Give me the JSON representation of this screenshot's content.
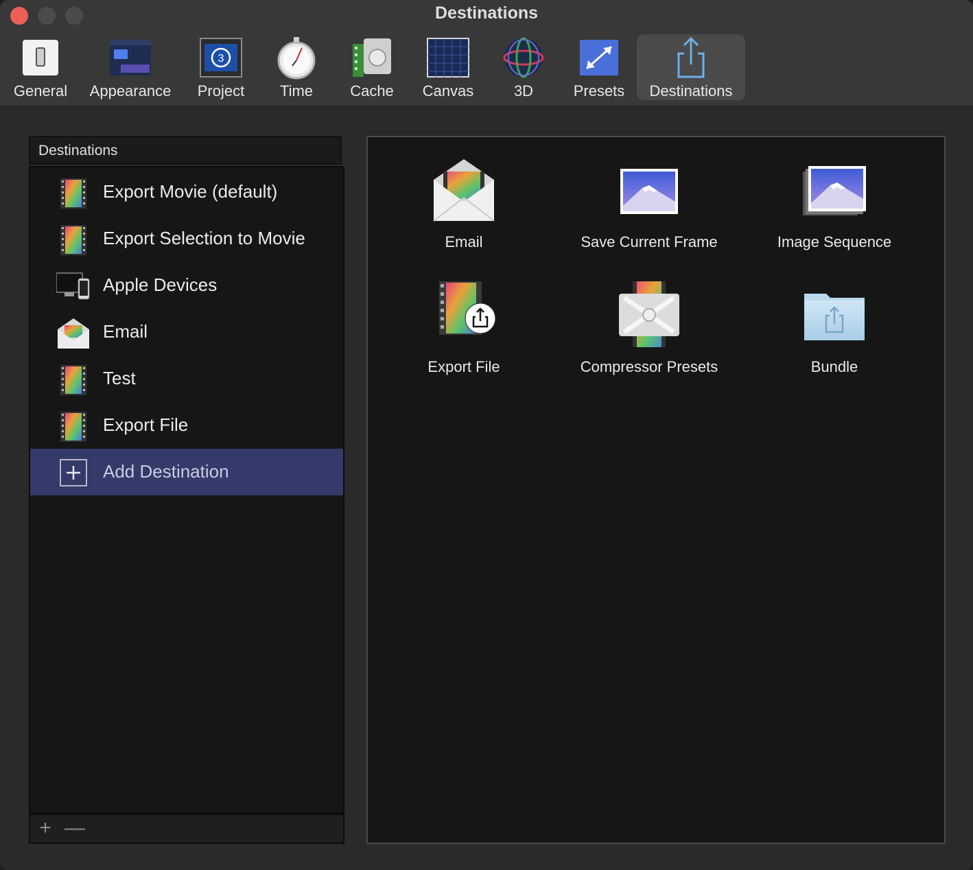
{
  "window": {
    "title": "Destinations"
  },
  "toolbar": {
    "items": [
      {
        "label": "General",
        "icon": "general-switch-icon"
      },
      {
        "label": "Appearance",
        "icon": "appearance-icon"
      },
      {
        "label": "Project",
        "icon": "project-icon"
      },
      {
        "label": "Time",
        "icon": "stopwatch-icon"
      },
      {
        "label": "Cache",
        "icon": "cache-icon"
      },
      {
        "label": "Canvas",
        "icon": "canvas-grid-icon"
      },
      {
        "label": "3D",
        "icon": "3d-sphere-icon"
      },
      {
        "label": "Presets",
        "icon": "presets-icon"
      },
      {
        "label": "Destinations",
        "icon": "share-icon",
        "selected": true
      }
    ]
  },
  "sidebar": {
    "header": "Destinations",
    "items": [
      {
        "label": "Export Movie (default)",
        "icon": "film-icon"
      },
      {
        "label": "Export Selection to Movie",
        "icon": "film-icon"
      },
      {
        "label": "Apple Devices",
        "icon": "devices-icon"
      },
      {
        "label": "Email",
        "icon": "email-icon"
      },
      {
        "label": "Test",
        "icon": "film-icon"
      },
      {
        "label": "Export File",
        "icon": "film-icon"
      },
      {
        "label": "Add Destination",
        "icon": "plus-box-icon",
        "selected": true
      }
    ],
    "footer": {
      "add": "+",
      "remove": "—"
    }
  },
  "destinations_grid": {
    "tiles": [
      {
        "label": "Email",
        "icon": "email-icon"
      },
      {
        "label": "Save Current Frame",
        "icon": "mountain-image-icon"
      },
      {
        "label": "Image Sequence",
        "icon": "image-stack-icon"
      },
      {
        "label": "Export File",
        "icon": "film-share-icon"
      },
      {
        "label": "Compressor Presets",
        "icon": "compressor-icon"
      },
      {
        "label": "Bundle",
        "icon": "folder-share-icon"
      }
    ]
  },
  "colors": {
    "selection": "#343a6a",
    "close": "#ec5f57"
  }
}
